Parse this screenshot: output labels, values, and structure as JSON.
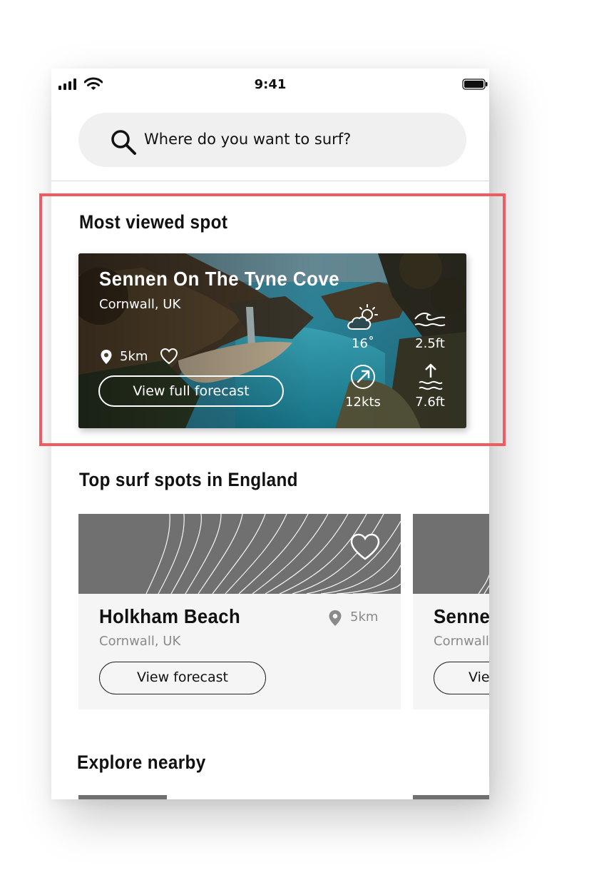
{
  "status_bar": {
    "time": "9:41"
  },
  "search": {
    "placeholder": "Where do you want to surf?"
  },
  "most_viewed": {
    "title": "Most viewed spot",
    "spot": {
      "name": "Sennen On The Tyne Cove",
      "region": "Cornwall, UK",
      "distance": "5km",
      "forecast_button": "View full forecast",
      "weather": {
        "temperature": "16˚",
        "wave_height": "2.5ft",
        "wind": "12kts",
        "tide": "7.6ft"
      }
    }
  },
  "top_spots": {
    "title": "Top surf spots in England",
    "cards": [
      {
        "name": "Holkham Beach",
        "region": "Cornwall, UK",
        "distance": "5km",
        "button": "View forecast"
      },
      {
        "name": "Sennen",
        "region": "Cornwall, UK",
        "button": "View forecast"
      }
    ]
  },
  "explore": {
    "title": "Explore nearby"
  },
  "icons": [
    "signal-icon",
    "wifi-icon",
    "battery-icon",
    "search-icon",
    "location-pin-icon",
    "heart-icon",
    "partly-sunny-icon",
    "wave-icon",
    "wind-icon",
    "tide-icon"
  ],
  "colors": {
    "highlight": "#f05a63",
    "card_bg": "#f5f5f5",
    "map_bg": "#707070",
    "search_bg": "#f0f0f0"
  }
}
